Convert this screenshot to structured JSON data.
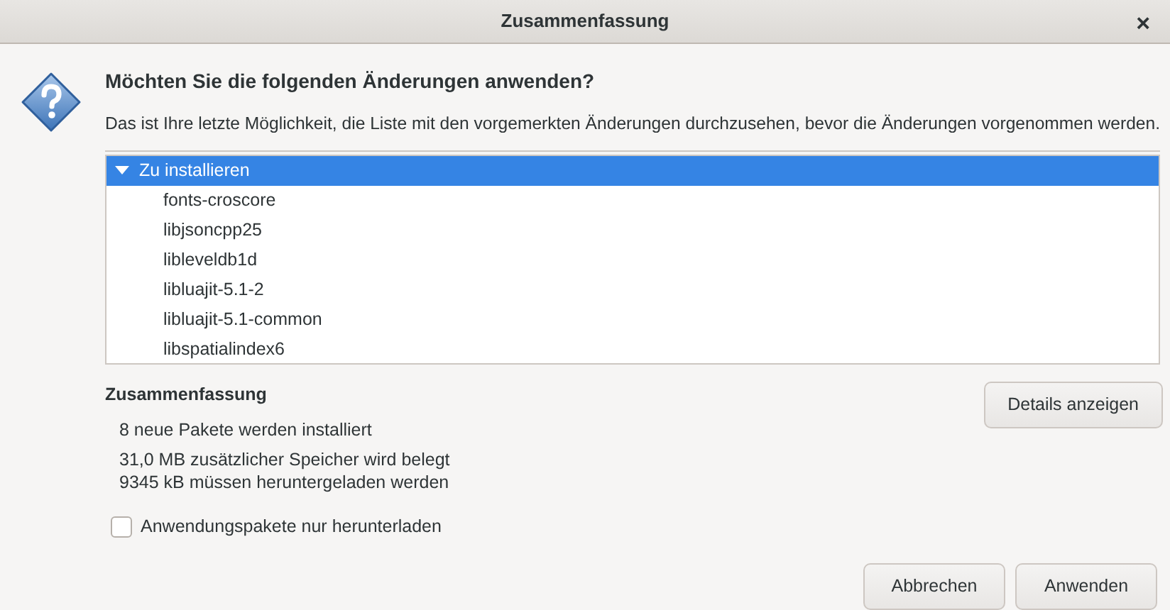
{
  "window": {
    "title": "Zusammenfassung",
    "close": "×"
  },
  "heading": "Möchten Sie die folgenden Änderungen anwenden?",
  "description": "Das ist Ihre letzte Möglichkeit, die Liste mit den vorgemerkten Änderungen durchzusehen, bevor die Änderungen vorgenommen werden.",
  "tree": [
    {
      "label": "Zu installieren",
      "expanded": true,
      "selected": true,
      "children": [
        {
          "label": "fonts-croscore",
          "selected": false
        },
        {
          "label": "libjsoncpp25",
          "selected": false
        },
        {
          "label": "libleveldb1d",
          "selected": false
        },
        {
          "label": "libluajit-5.1-2",
          "selected": false
        },
        {
          "label": "libluajit-5.1-common",
          "selected": false
        },
        {
          "label": "libspatialindex6",
          "selected": false
        }
      ]
    }
  ],
  "summary": {
    "title": "Zusammenfassung",
    "lines": [
      "8 neue Pakete werden installiert",
      "31,0 MB zusätzlicher Speicher wird belegt",
      "9345 kB müssen heruntergeladen werden"
    ],
    "details_button": "Details anzeigen"
  },
  "download_only": {
    "label": "Anwendungspakete nur herunterladen",
    "checked": false
  },
  "buttons": [
    "Abbrechen",
    "Anwenden"
  ]
}
